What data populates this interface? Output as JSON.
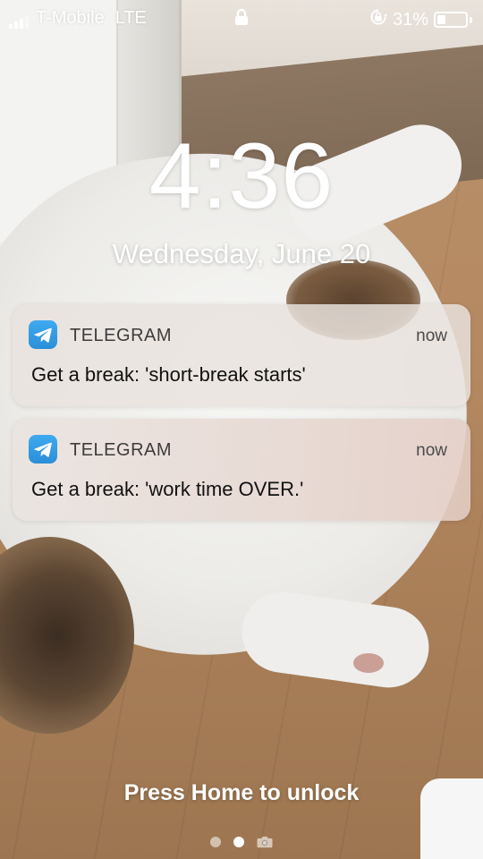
{
  "status_bar": {
    "carrier": "T-Mobile",
    "network": "LTE",
    "battery_percent": "31%",
    "battery_level": 0.31,
    "signal_bars_filled": 3,
    "signal_bars_total": 4,
    "lock_icon": "lock-icon",
    "rotation_lock_icon": "rotation-lock-icon"
  },
  "lock_screen": {
    "time": "4:36",
    "date": "Wednesday, June 20",
    "unlock_hint": "Press Home to unlock"
  },
  "notifications": [
    {
      "app": "TELEGRAM",
      "time": "now",
      "message": "Get a break: 'short-break starts'",
      "icon": "telegram-icon"
    },
    {
      "app": "TELEGRAM",
      "time": "now",
      "message": "Get a break: 'work time OVER.'",
      "icon": "telegram-icon"
    }
  ],
  "page_indicator": {
    "pages": 2,
    "active_page": 2,
    "extra_icon": "camera-icon"
  },
  "colors": {
    "telegram_blue": "#2b8fd8"
  }
}
